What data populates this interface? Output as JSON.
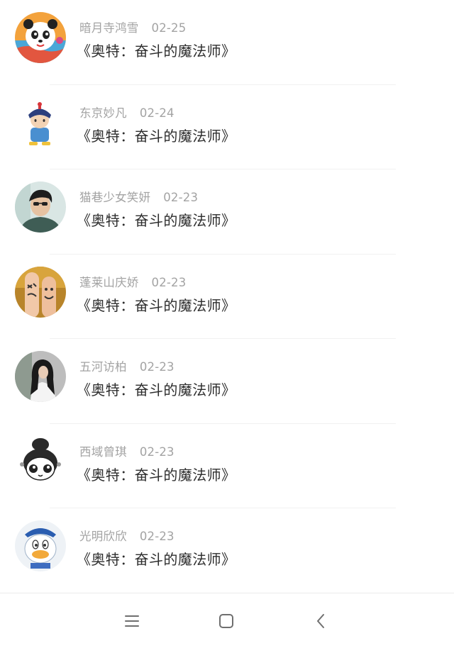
{
  "items": [
    {
      "name": "暗月寺鸿雪",
      "date": "02-25",
      "title": "《奥特：奋斗的魔法师》",
      "avatar_icon": "panda-avatar-icon"
    },
    {
      "name": "东京妙凡",
      "date": "02-24",
      "title": "《奥特：奋斗的魔法师》",
      "avatar_icon": "qing-official-cartoon-avatar-icon"
    },
    {
      "name": "猫巷少女笑妍",
      "date": "02-23",
      "title": "《奥特：奋斗的魔法师》",
      "avatar_icon": "young-man-photo-avatar-icon"
    },
    {
      "name": "蓬莱山庆娇",
      "date": "02-23",
      "title": "《奥特：奋斗的魔法师》",
      "avatar_icon": "finger-faces-avatar-icon"
    },
    {
      "name": "五河访柏",
      "date": "02-23",
      "title": "《奥特：奋斗的魔法师》",
      "avatar_icon": "girl-photo-avatar-icon"
    },
    {
      "name": "西域曾琪",
      "date": "02-23",
      "title": "《奥特：奋斗的魔法师》",
      "avatar_icon": "cartoon-bun-girl-avatar-icon"
    },
    {
      "name": "光明欣欣",
      "date": "02-23",
      "title": "《奥特：奋斗的魔法师》",
      "avatar_icon": "donald-duck-avatar-icon"
    }
  ],
  "navbar": {
    "menu_icon": "menu-icon",
    "home_icon": "home-square-icon",
    "back_icon": "back-chevron-icon"
  },
  "colors": {
    "meta_text": "#a3a3a3",
    "title_text": "#2d2d2d",
    "divider": "#f1f1f1",
    "nav_icon": "#6f6f6f"
  }
}
